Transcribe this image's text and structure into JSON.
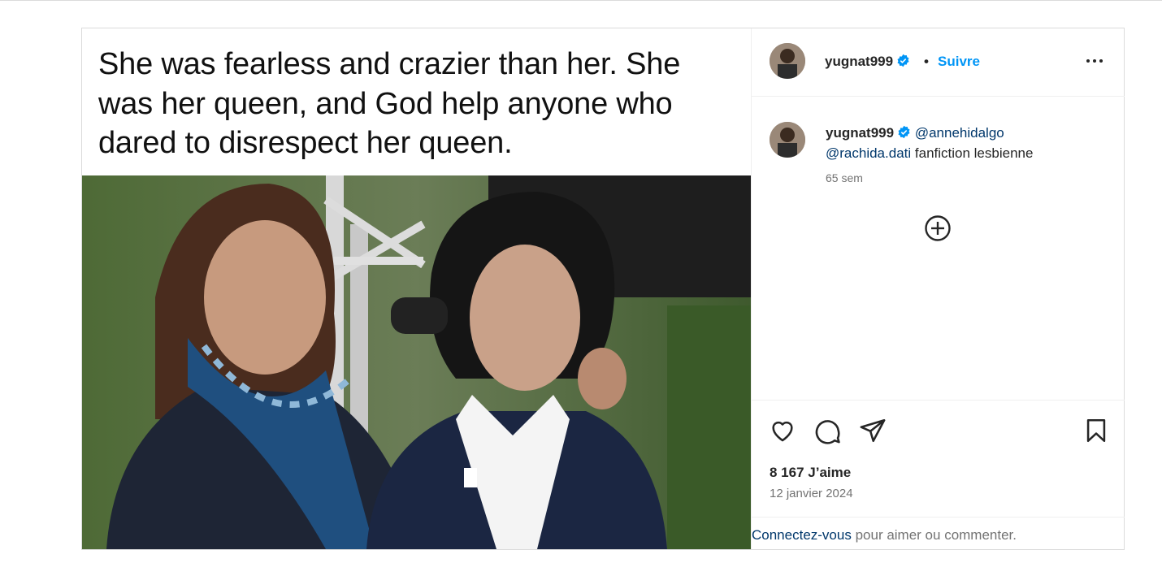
{
  "post": {
    "image_caption": "She was fearless and crazier than her. She was her queen, and God help anyone who dared to disrespect her queen.",
    "header": {
      "username": "yugnat999",
      "separator": "•",
      "follow_label": "Suivre"
    },
    "comment": {
      "username": "yugnat999",
      "mention_1": "@annehidalgo",
      "mention_2": "@rachida.dati",
      "text": "fanfiction lesbienne",
      "time": "65 sem"
    },
    "likes": "8 167 J’aime",
    "date": "12 janvier 2024",
    "login_link": "Connectez-vous",
    "login_rest": "pour aimer ou commenter."
  },
  "colors": {
    "accent": "#0095f6",
    "link": "#00376b",
    "muted": "#737373"
  },
  "icons": [
    "verified-badge-icon",
    "more-options-icon",
    "add-circle-icon",
    "heart-icon",
    "comment-icon",
    "share-icon",
    "bookmark-icon"
  ]
}
